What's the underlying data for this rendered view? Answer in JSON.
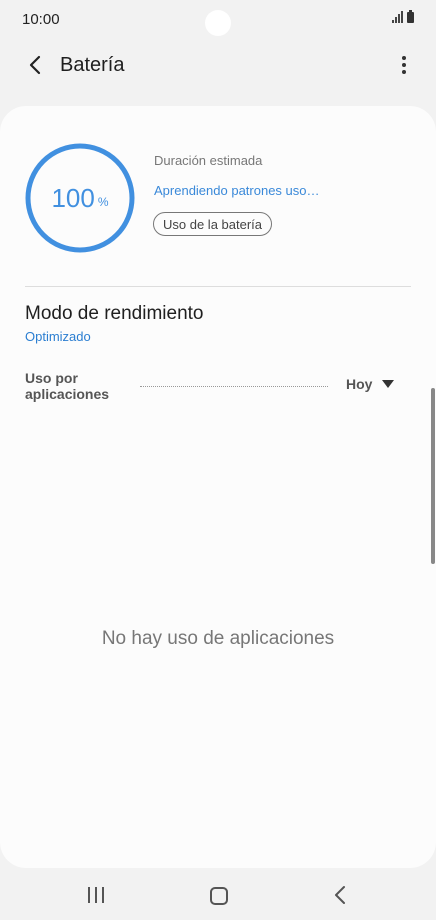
{
  "status_bar": {
    "time": "10:00",
    "icons": [
      "signal-icon",
      "battery-icon"
    ]
  },
  "app_bar": {
    "title": "Batería",
    "back_icon": "chevron-left-icon",
    "more_icon": "more-vertical-icon"
  },
  "battery": {
    "level": "100",
    "unit": "%",
    "level_fraction": 1.0,
    "estimated_label": "Duración estimada",
    "learning_text": "Aprendiendo patrones uso…",
    "usage_button_label": "Uso de la batería",
    "accent_color": "#4190e0"
  },
  "performance": {
    "title": "Modo de rendimiento",
    "value": "Optimizado"
  },
  "app_usage": {
    "label_line1": "Uso por",
    "label_line2": "aplicaciones",
    "period": "Hoy",
    "empty_message": "No hay uso de aplicaciones"
  },
  "nav_bar": {
    "icons": [
      "recents-icon",
      "home-icon",
      "back-icon"
    ]
  }
}
